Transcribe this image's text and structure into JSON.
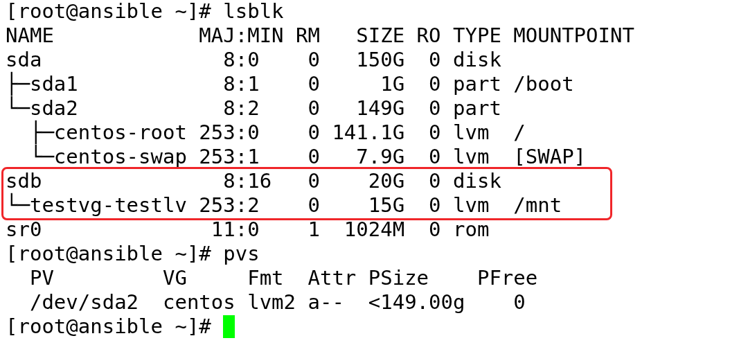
{
  "terminal": {
    "lines": [
      {
        "text": "[root@ansible ~]# lsblk",
        "highlighted": false
      },
      {
        "text": "NAME            MAJ:MIN RM   SIZE RO TYPE MOUNTPOINT",
        "highlighted": false
      },
      {
        "text": "sda               8:0    0   150G  0 disk",
        "highlighted": false
      },
      {
        "text": "├─sda1            8:1    0     1G  0 part /boot",
        "highlighted": false
      },
      {
        "text": "└─sda2            8:2    0   149G  0 part",
        "highlighted": false
      },
      {
        "text": "  ├─centos-root 253:0    0 141.1G  0 lvm  /",
        "highlighted": false
      },
      {
        "text": "  └─centos-swap 253:1    0   7.9G  0 lvm  [SWAP]",
        "highlighted": false
      },
      {
        "text": "sdb               8:16   0    20G  0 disk",
        "highlighted": true
      },
      {
        "text": "└─testvg-testlv 253:2    0    15G  0 lvm  /mnt",
        "highlighted": true
      },
      {
        "text": "sr0              11:0    1  1024M  0 rom",
        "highlighted": false
      },
      {
        "text": "[root@ansible ~]# pvs",
        "highlighted": false
      },
      {
        "text": "  PV         VG     Fmt  Attr PSize    PFree",
        "highlighted": false
      },
      {
        "text": "  /dev/sda2  centos lvm2 a--  <149.00g    0",
        "highlighted": false
      },
      {
        "text": "[root@ansible ~]# ",
        "highlighted": false,
        "cursor": true
      }
    ]
  }
}
